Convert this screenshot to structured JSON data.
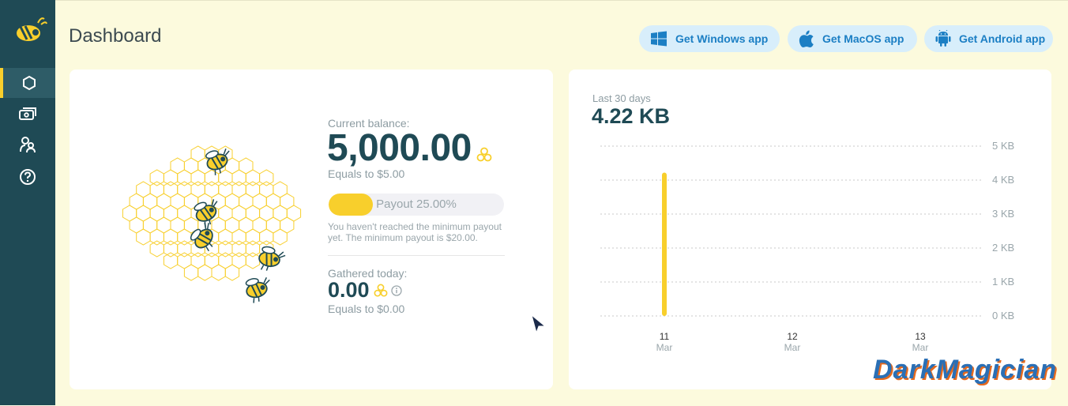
{
  "sidebar": {
    "logo": "bee-logo",
    "items": [
      {
        "icon": "hexagon-icon",
        "active": true
      },
      {
        "icon": "money-icon",
        "active": false
      },
      {
        "icon": "people-icon",
        "active": false
      },
      {
        "icon": "help-icon",
        "active": false
      }
    ]
  },
  "header": {
    "title": "Dashboard",
    "buttons": [
      {
        "label": "Get Windows app",
        "icon": "windows-icon"
      },
      {
        "label": "Get MacOS app",
        "icon": "apple-icon"
      },
      {
        "label": "Get Android app",
        "icon": "android-icon"
      }
    ]
  },
  "balance": {
    "current_label": "Current balance:",
    "current_value": "5,000.00",
    "equals": "Equals to $5.00",
    "payout_label": "Payout 25.00%",
    "payout_fraction": 0.25,
    "payout_note": "You haven't reached the minimum payout yet. The minimum payout is $20.00.",
    "gathered_label": "Gathered today:",
    "gathered_value": "0.00",
    "gathered_equals": "Equals to $0.00"
  },
  "traffic": {
    "period_label": "Last 30 days",
    "total": "4.22 KB"
  },
  "chart_data": {
    "type": "bar",
    "title": "",
    "xlabel": "",
    "ylabel": "",
    "ylim": [
      0,
      5
    ],
    "y_unit": "KB",
    "y_ticks": [
      "5 KB",
      "4 KB",
      "3 KB",
      "2 KB",
      "1 KB",
      "0 KB"
    ],
    "x_ticks": [
      {
        "day": "11",
        "month": "Mar"
      },
      {
        "day": "12",
        "month": "Mar"
      },
      {
        "day": "13",
        "month": "Mar"
      }
    ],
    "series": [
      {
        "values": [
          4.22
        ]
      }
    ],
    "categories": [
      "11 Mar"
    ],
    "grid": true,
    "bar_color": "#f8cf2c"
  },
  "watermark": "DarkMagician",
  "colors": {
    "accent": "#f8cf2c",
    "sidebar": "#1f4a55",
    "button_bg": "#d8eefb",
    "button_text": "#1c7fc4"
  }
}
